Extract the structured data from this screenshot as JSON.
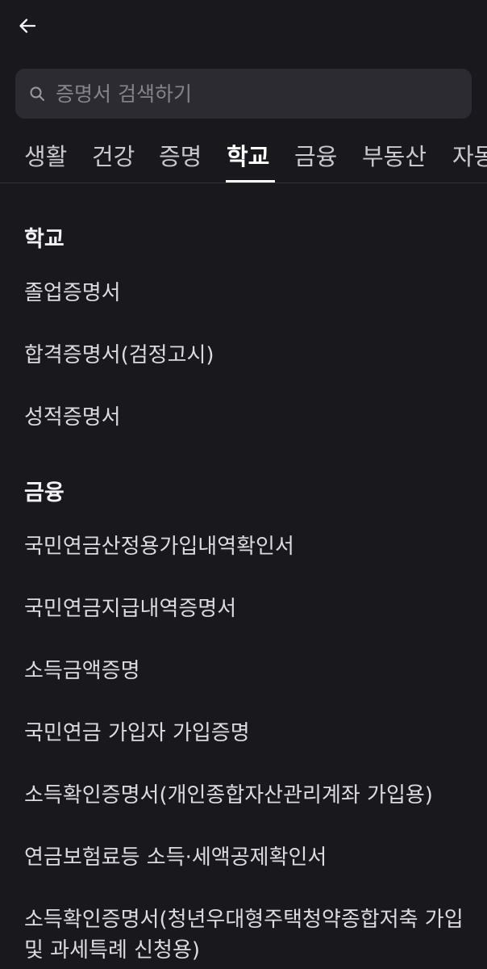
{
  "search": {
    "placeholder": "증명서 검색하기"
  },
  "tabs": [
    {
      "label": "생활"
    },
    {
      "label": "건강"
    },
    {
      "label": "증명"
    },
    {
      "label": "학교"
    },
    {
      "label": "금융"
    },
    {
      "label": "부동산"
    },
    {
      "label": "자동차"
    }
  ],
  "active_tab": "학교",
  "sections": [
    {
      "title": "학교",
      "items": [
        {
          "label": "졸업증명서"
        },
        {
          "label": "합격증명서(검정고시)"
        },
        {
          "label": "성적증명서"
        }
      ]
    },
    {
      "title": "금융",
      "items": [
        {
          "label": "국민연금산정용가입내역확인서"
        },
        {
          "label": "국민연금지급내역증명서"
        },
        {
          "label": "소득금액증명"
        },
        {
          "label": "국민연금 가입자 가입증명"
        },
        {
          "label": "소득확인증명서(개인종합자산관리계좌 가입용)"
        },
        {
          "label": "연금보험료등 소득·세액공제확인서"
        },
        {
          "label": "소득확인증명서(청년우대형주택청약종합저축 가입 및 과세특례 신청용)"
        }
      ]
    }
  ],
  "colors": {
    "background": "#19181d",
    "search_bg": "#2b2b31",
    "text": "#dcdbe2",
    "active_tab": "#ffffff"
  }
}
